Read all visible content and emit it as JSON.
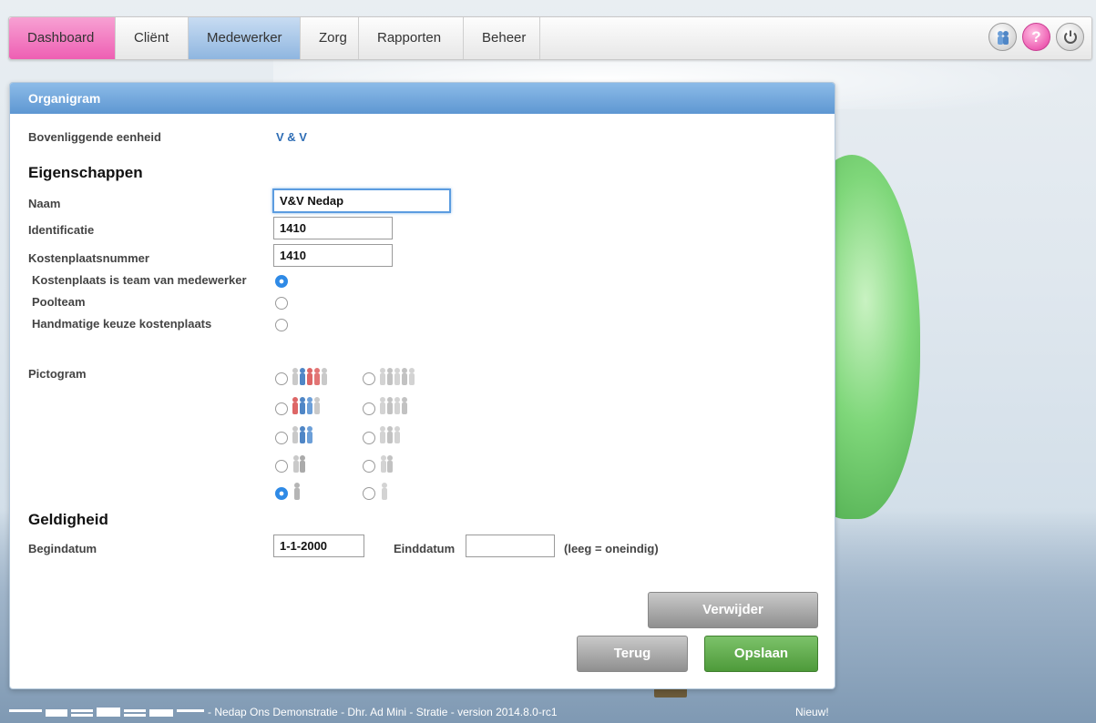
{
  "nav": {
    "tabs": [
      {
        "label": "Dashboard"
      },
      {
        "label": "Cliënt"
      },
      {
        "label": "Medewerker"
      },
      {
        "label": "Zorg"
      },
      {
        "label": "Rapporten"
      },
      {
        "label": "Beheer"
      }
    ],
    "help_label": "?"
  },
  "panel": {
    "title": "Organigram",
    "parent_unit_label": "Bovenliggende eenheid",
    "parent_unit_value": "V & V",
    "properties_heading": "Eigenschappen",
    "name_label": "Naam",
    "name_value": "V&V Nedap",
    "identification_label": "Identificatie",
    "identification_value": "1410",
    "cost_center_label": "Kostenplaatsnummer",
    "cost_center_value": "1410",
    "options": [
      {
        "label": "Kostenplaats is team van medewerker",
        "selected": true
      },
      {
        "label": "Poolteam",
        "selected": false
      },
      {
        "label": "Handmatige keuze kostenplaats",
        "selected": false
      }
    ],
    "pictogram_label": "Pictogram",
    "pictogram_selected": "single-grey",
    "validity_heading": "Geldigheid",
    "start_label": "Begindatum",
    "start_value": "1-1-2000",
    "end_label": "Einddatum",
    "end_value": "",
    "end_hint": "(leeg = oneindig)",
    "delete_label": "Verwijder",
    "back_label": "Terug",
    "save_label": "Opslaan"
  },
  "footer": {
    "logo_text": "nedap",
    "info": "- Nedap Ons Demonstratie - Dhr. Ad Mini - Stratie - version 2014.8.0-rc1",
    "new_label": "Nieuw!"
  },
  "colors": {
    "dashboard_tab": "#ee5fb3",
    "active_tab": "#8fb6e0",
    "panel_header": "#5e97d2",
    "link": "#2e6db5",
    "save_button": "#4e9a3a"
  }
}
